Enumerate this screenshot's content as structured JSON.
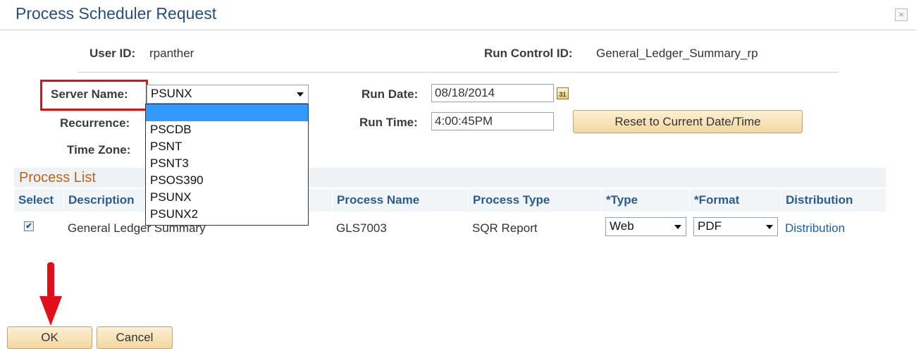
{
  "dialog": {
    "title": "Process Scheduler Request",
    "close_glyph": "×"
  },
  "header": {
    "user_id_label": "User ID:",
    "user_id_value": "rpanther",
    "run_control_label": "Run Control ID:",
    "run_control_value": "General_Ledger_Summary_rp"
  },
  "form": {
    "server_name_label": "Server Name:",
    "server_name_value": "PSUNX",
    "server_options": [
      "",
      "PSCDB",
      "PSNT",
      "PSNT3",
      "PSOS390",
      "PSUNX",
      "PSUNX2"
    ],
    "recurrence_label": "Recurrence:",
    "time_zone_label": "Time Zone:",
    "run_date_label": "Run Date:",
    "run_date_value": "08/18/2014",
    "calendar_glyph": "31",
    "run_time_label": "Run Time:",
    "run_time_value": "4:00:45PM",
    "reset_button": "Reset to Current Date/Time"
  },
  "process_list": {
    "title": "Process List",
    "columns": {
      "select": "Select",
      "description": "Description",
      "process_name": "Process Name",
      "process_type": "Process Type",
      "type": "*Type",
      "format": "*Format",
      "distribution": "Distribution"
    },
    "rows": [
      {
        "checked": "✔",
        "description": "General Ledger Summary",
        "process_name": "GLS7003",
        "process_type": "SQR Report",
        "type": "Web",
        "format": "PDF",
        "distribution": "Distribution"
      }
    ]
  },
  "footer": {
    "ok": "OK",
    "cancel": "Cancel"
  },
  "colors": {
    "title": "#2a4e7a",
    "highlight": "#e0101a",
    "accent": "#b5651d",
    "link": "#1d5ea4",
    "selection": "#3399ff"
  }
}
